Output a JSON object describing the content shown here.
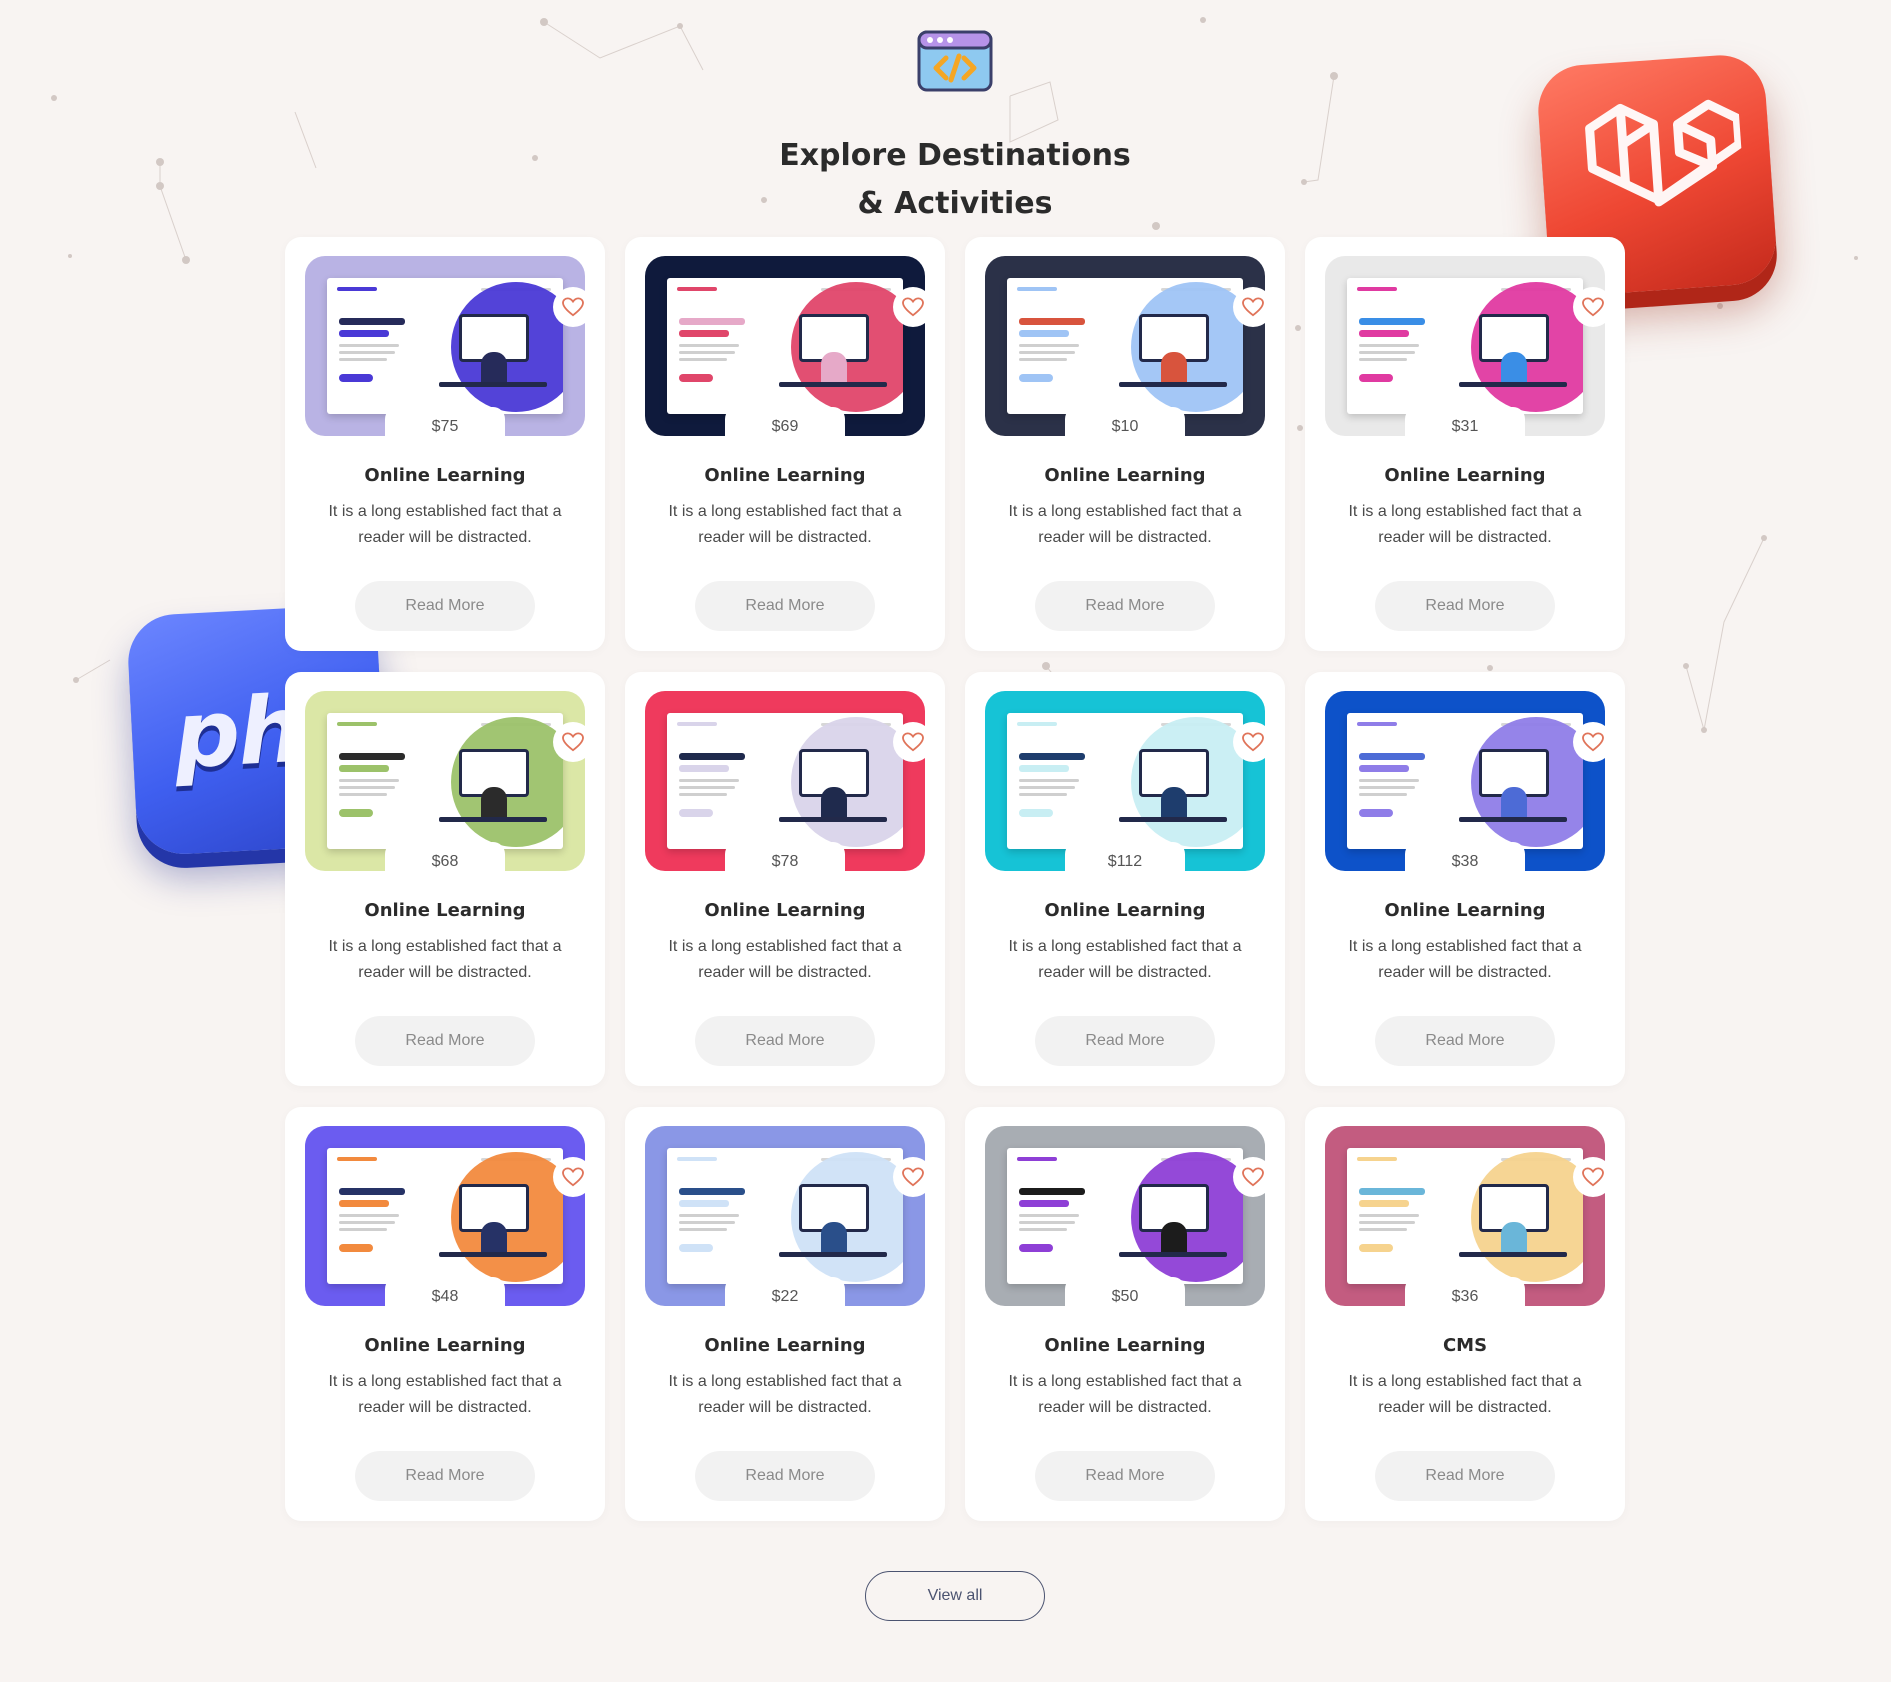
{
  "section": {
    "heading_line1": "Explore Destinations",
    "heading_line2": "& Activities",
    "header_icon": "code-window-icon"
  },
  "decorations": {
    "laravel_badge_icon": "laravel-logo-icon",
    "php_badge_text": "php"
  },
  "colors": {
    "background": "#f8f4f2",
    "card": "#ffffff",
    "heart": "#e0745a",
    "laravel": "#ee4733",
    "php": "#3f5ff0",
    "view_all_border": "#4b5370"
  },
  "cards": [
    {
      "price": "$75",
      "title": "Online Learning",
      "description": "It is a long established fact that a reader will be distracted.",
      "button": "Read More",
      "thumb_bg": "#b9b3e4",
      "accent": "#4a39d6",
      "figure": "#262b5a"
    },
    {
      "price": "$69",
      "title": "Online Learning",
      "description": "It is a long established fact that a reader will be distracted.",
      "button": "Read More",
      "thumb_bg": "#0f1a3c",
      "accent": "#e0466a",
      "figure": "#e6a9c8"
    },
    {
      "price": "$10",
      "title": "Online Learning",
      "description": "It is a long established fact that a reader will be distracted.",
      "button": "Read More",
      "thumb_bg": "#2b3148",
      "accent": "#9fc4f5",
      "figure": "#d8543d"
    },
    {
      "price": "$31",
      "title": "Online Learning",
      "description": "It is a long established fact that a reader will be distracted.",
      "button": "Read More",
      "thumb_bg": "#e9e9e9",
      "accent": "#e03aa1",
      "figure": "#3a8ee6"
    },
    {
      "price": "$68",
      "title": "Online Learning",
      "description": "It is a long established fact that a reader will be distracted.",
      "button": "Read More",
      "thumb_bg": "#dbe7a6",
      "accent": "#9cc26a",
      "figure": "#2b2b2b"
    },
    {
      "price": "$78",
      "title": "Online Learning",
      "description": "It is a long established fact that a reader will be distracted.",
      "button": "Read More",
      "thumb_bg": "#ef3a5d",
      "accent": "#d9d4ea",
      "figure": "#1f2a4d"
    },
    {
      "price": "$112",
      "title": "Online Learning",
      "description": "It is a long established fact that a reader will be distracted.",
      "button": "Read More",
      "thumb_bg": "#16c3d6",
      "accent": "#c8eef3",
      "figure": "#1e3d6d"
    },
    {
      "price": "$38",
      "title": "Online Learning",
      "description": "It is a long established fact that a reader will be distracted.",
      "button": "Read More",
      "thumb_bg": "#0d52c9",
      "accent": "#8f7de8",
      "figure": "#4d6bd6"
    },
    {
      "price": "$48",
      "title": "Online Learning",
      "description": "It is a long established fact that a reader will be distracted.",
      "button": "Read More",
      "thumb_bg": "#6b5cf0",
      "accent": "#f28a3e",
      "figure": "#263266"
    },
    {
      "price": "$22",
      "title": "Online Learning",
      "description": "It is a long established fact that a reader will be distracted.",
      "button": "Read More",
      "thumb_bg": "#8a97e6",
      "accent": "#cfe2f7",
      "figure": "#2a4f8a"
    },
    {
      "price": "$50",
      "title": "Online Learning",
      "description": "It is a long established fact that a reader will be distracted.",
      "button": "Read More",
      "thumb_bg": "#a8adb3",
      "accent": "#8e3fd6",
      "figure": "#1c1c1c"
    },
    {
      "price": "$36",
      "title": "CMS",
      "description": "It is a long established fact that a reader will be distracted.",
      "button": "Read More",
      "thumb_bg": "#c35c80",
      "accent": "#f6d38e",
      "figure": "#6ab6d9"
    }
  ],
  "footer": {
    "view_all_label": "View all"
  }
}
